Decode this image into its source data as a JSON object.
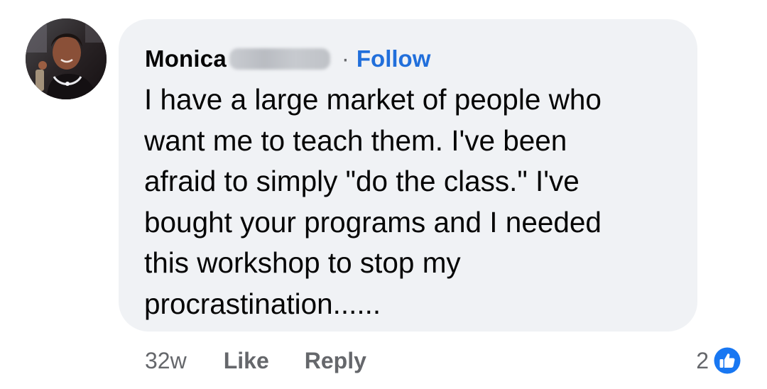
{
  "comment": {
    "author": {
      "name_visible": "Monica",
      "follow_label": "Follow",
      "separator": "·"
    },
    "text": "I have a large market of people who\nwant me to teach them. I've been\nafraid to simply \"do the class.\" I've\nbought your programs and I needed\nthis workshop to stop my\nprocrastination......",
    "timestamp": "32w",
    "like_label": "Like",
    "reply_label": "Reply",
    "reaction_count": "2",
    "reaction_icon": "thumbs-up-icon"
  },
  "colors": {
    "bubble_bg": "#f0f2f5",
    "link_blue": "#216fdb",
    "secondary_text": "#65676b",
    "primary_text": "#050505",
    "like_badge": "#1877f2"
  }
}
